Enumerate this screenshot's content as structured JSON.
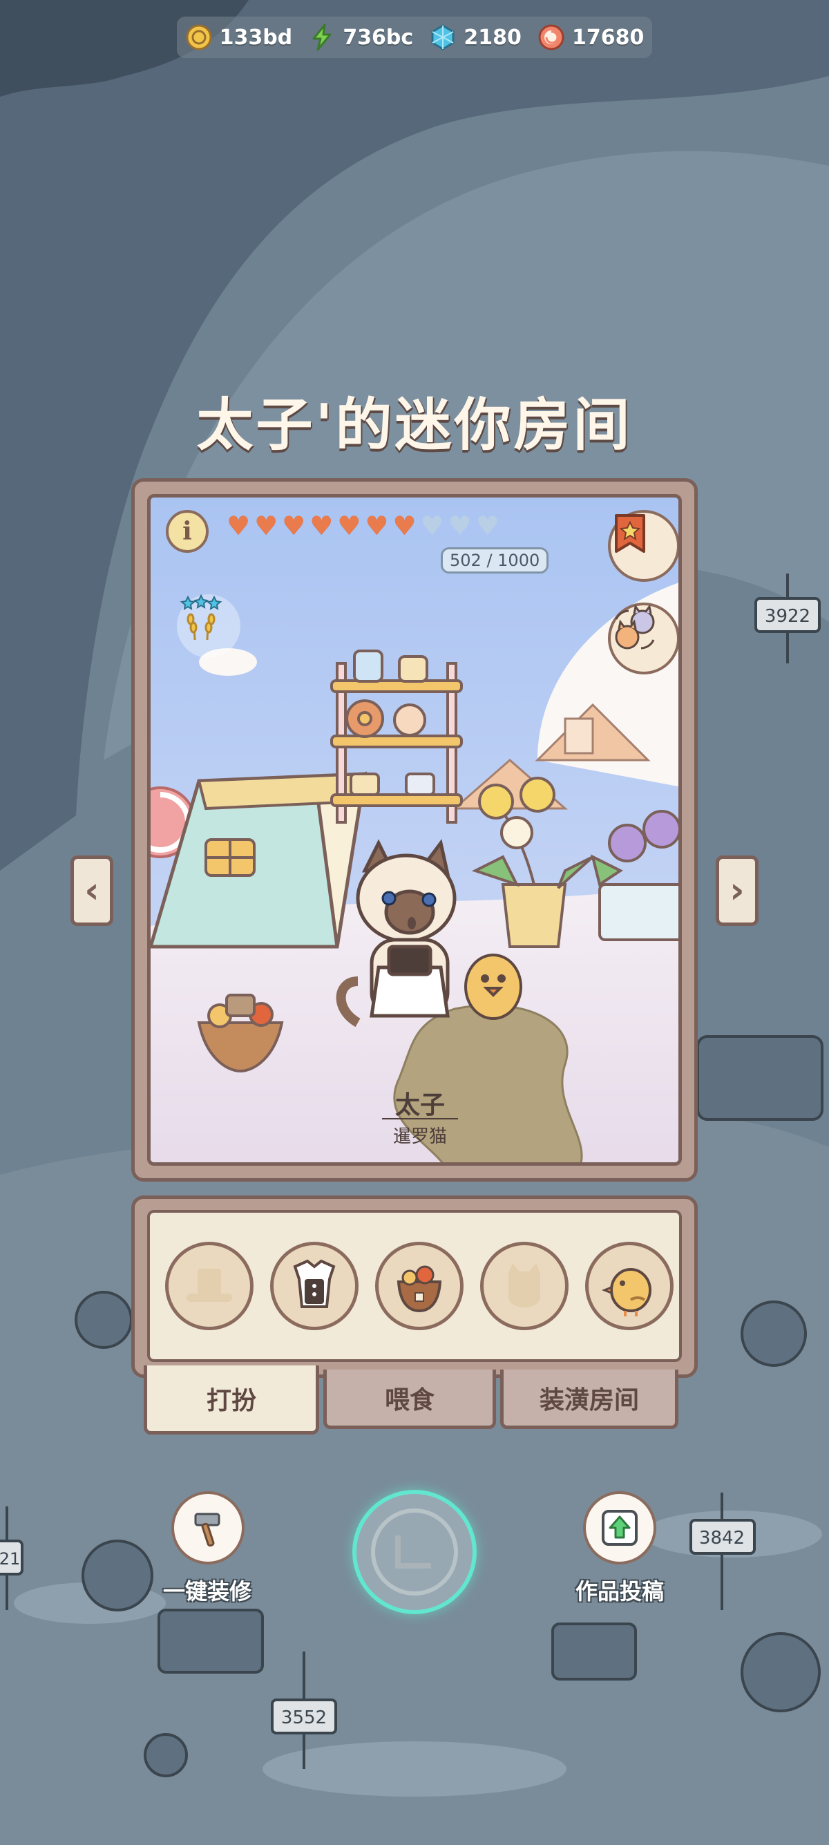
{
  "currency": [
    {
      "icon": "gold-coin-icon",
      "value": "133bd"
    },
    {
      "icon": "energy-bolt-icon",
      "value": "736bc"
    },
    {
      "icon": "blue-gem-icon",
      "value": "2180"
    },
    {
      "icon": "fish-cake-icon",
      "value": "17680"
    }
  ],
  "title": "太子'的迷你房间",
  "room": {
    "affection": "502 / 1000",
    "hearts_total": 10,
    "hearts_filled": 7,
    "cat_name": "太子",
    "cat_breed": "暹罗猫"
  },
  "item_slots": [
    {
      "icon": "hat-slot-icon",
      "equipped": false
    },
    {
      "icon": "apron-outfit-icon",
      "equipped": true
    },
    {
      "icon": "food-bowl-icon",
      "equipped": true
    },
    {
      "icon": "pet-slot-icon",
      "equipped": false
    },
    {
      "icon": "chick-pet-icon",
      "equipped": true
    }
  ],
  "tabs": {
    "dress_up": "打扮",
    "feed": "喂食",
    "decorate": "装潢房间"
  },
  "actions": {
    "one_click_decorate": "一键装修",
    "submit_work": "作品投稿"
  },
  "background_signs": [
    "3922",
    "3842",
    "3552",
    "21"
  ],
  "colors": {
    "heart_full": "#ea7b4c",
    "heart_empty": "#b9cfe6",
    "frame": "#7b605a",
    "accent_ring": "#62e6cf"
  }
}
